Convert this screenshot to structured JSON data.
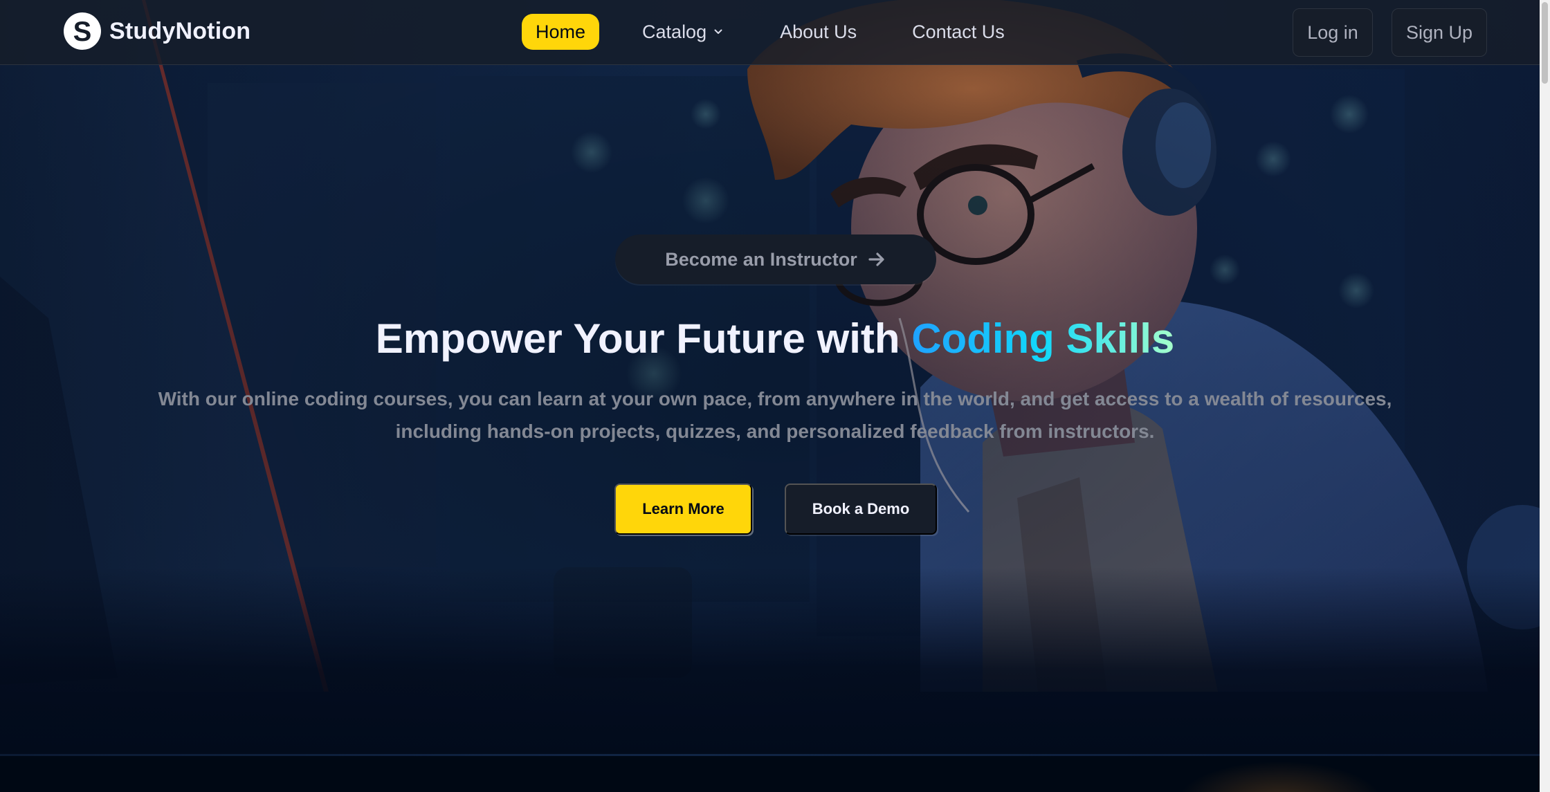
{
  "brand": {
    "logo_letter": "S",
    "name": "StudyNotion"
  },
  "nav": {
    "items": [
      {
        "label": "Home",
        "active": true
      },
      {
        "label": "Catalog",
        "has_dropdown": true
      },
      {
        "label": "About Us"
      },
      {
        "label": "Contact Us"
      }
    ]
  },
  "auth": {
    "login_label": "Log in",
    "signup_label": "Sign Up"
  },
  "hero": {
    "instructor_cta": "Become an Instructor",
    "title_prefix": "Empower Your Future with ",
    "title_highlight": "Coding Skills",
    "description": "With our online coding courses, you can learn at your own pace, from anywhere in the world, and get access to a wealth of resources, including hands-on projects, quizzes, and personalized feedback from instructors.",
    "primary_button": "Learn More",
    "secondary_button": "Book a Demo"
  },
  "icons": {
    "catalog_dropdown": "chevron-down-icon",
    "instructor_arrow": "arrow-right-icon"
  },
  "colors": {
    "accent_yellow": "#FFD60A",
    "nav_bg": "#161D29",
    "page_bg": "#000814",
    "gradient": [
      "#1FA2FF",
      "#12D8FA",
      "#A6FFCB"
    ]
  }
}
